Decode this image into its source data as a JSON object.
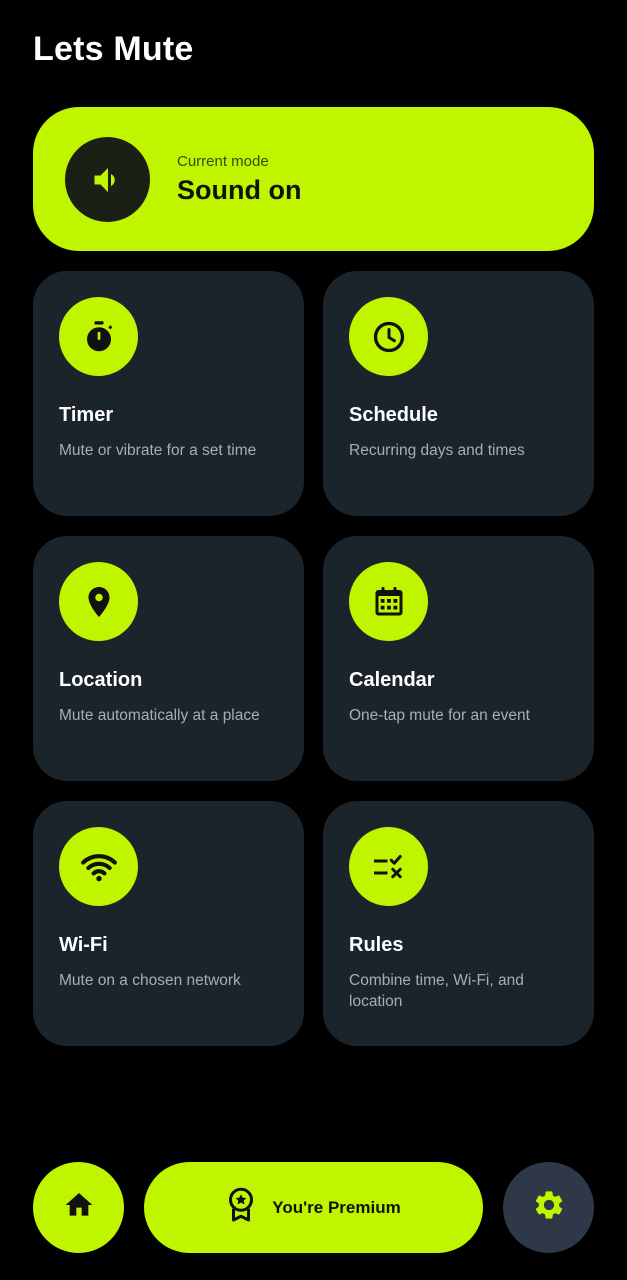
{
  "app": {
    "title": "Lets Mute"
  },
  "mode": {
    "label": "Current mode",
    "value": "Sound on",
    "icon": "speaker-icon"
  },
  "tiles": [
    {
      "title": "Timer",
      "desc": "Mute or vibrate for a set time",
      "icon": "stopwatch-icon"
    },
    {
      "title": "Schedule",
      "desc": "Recurring days and times",
      "icon": "clock-icon"
    },
    {
      "title": "Location",
      "desc": "Mute automatically at a place",
      "icon": "location-pin-icon"
    },
    {
      "title": "Calendar",
      "desc": "One-tap mute for an event",
      "icon": "calendar-icon"
    },
    {
      "title": "Wi-Fi",
      "desc": "Mute on a chosen network",
      "icon": "wifi-icon"
    },
    {
      "title": "Rules",
      "desc": "Combine time, Wi-Fi, and location",
      "icon": "rules-icon"
    }
  ],
  "nav": {
    "home_icon": "home-icon",
    "premium_label": "You're Premium",
    "premium_icon": "premium-badge-icon",
    "settings_icon": "gear-icon"
  },
  "colors": {
    "background": "#000000",
    "accent": "#c0f500",
    "tile": "#1b242b",
    "settings_button": "#2e3848"
  }
}
